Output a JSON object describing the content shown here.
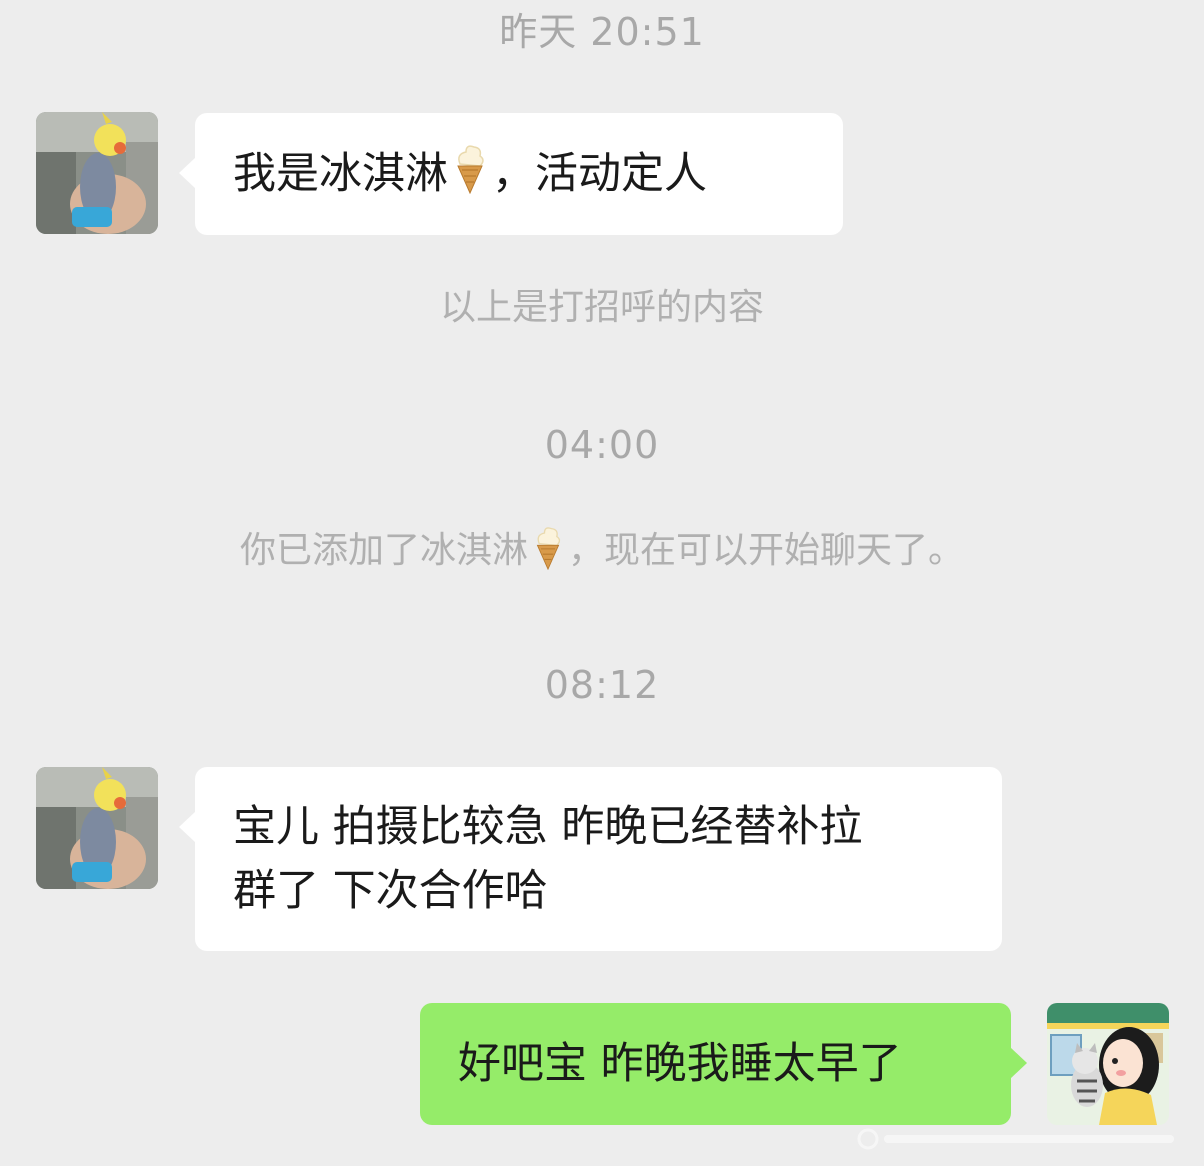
{
  "chat": {
    "timestamps": [
      "昨天 20:51",
      "04:00",
      "08:12"
    ],
    "messages": [
      {
        "side": "left",
        "text_before_icon": "我是冰淇淋",
        "icon": "ice-cream-cone-icon",
        "text_after_icon": "，活动定人"
      },
      {
        "side": "left",
        "lines": [
          "宝儿 拍摄比较急 昨晚已经替补拉",
          "群了 下次合作哈"
        ]
      },
      {
        "side": "right",
        "text": "好吧宝 昨晚我睡太早了"
      }
    ],
    "system_notes": {
      "greeting_note": "以上是打招呼的内容",
      "added_note_before_icon": "你已添加了冰淇淋",
      "added_note_icon": "ice-cream-cone-icon",
      "added_note_after_icon": "，现在可以开始聊天了。"
    },
    "contact_avatar": "bird-photo-avatar",
    "self_avatar": "cartoon-girl-with-cat-avatar"
  },
  "colors": {
    "background": "#ededed",
    "left_bubble": "#ffffff",
    "right_bubble": "#95ec69",
    "system_text": "#a8a8a8"
  }
}
